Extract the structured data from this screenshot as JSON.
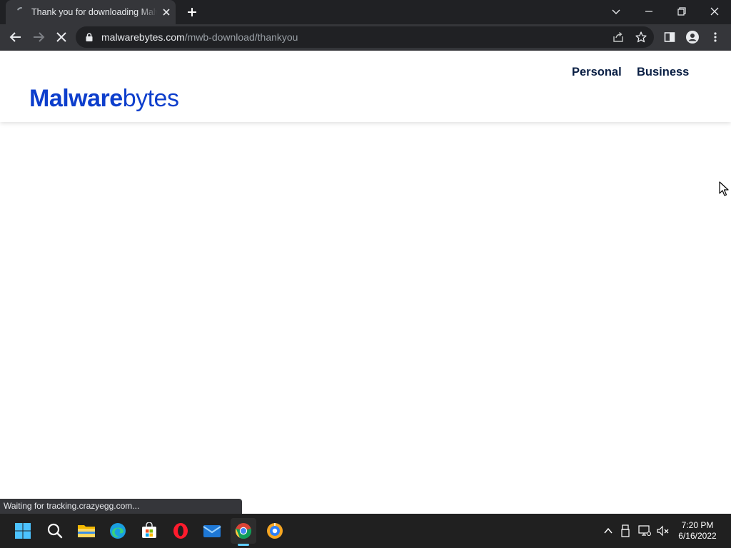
{
  "browser": {
    "tab": {
      "title": "Thank you for downloading Malwarebytes",
      "favicon": "loading-spinner-icon"
    },
    "url": {
      "host": "malwarebytes.com",
      "path": "/mwb-download/thankyou"
    },
    "status_text": "Waiting for tracking.crazyegg.com...",
    "colors": {
      "tabstrip": "#202124",
      "toolbar": "#35363a",
      "omnibox": "#202124"
    }
  },
  "site": {
    "logo": {
      "bold_part": "Malware",
      "light_part": "bytes",
      "color": "#0d3ecc"
    },
    "nav": {
      "personal": "Personal",
      "business": "Business"
    }
  },
  "taskbar": {
    "apps": [
      "start-icon",
      "search-icon",
      "file-explorer-icon",
      "edge-icon",
      "store-icon",
      "opera-icon",
      "mail-icon",
      "chrome-icon",
      "extra-browser-icon"
    ],
    "active_app": "chrome-icon",
    "clock": {
      "time": "7:20 PM",
      "date": "6/16/2022"
    }
  }
}
